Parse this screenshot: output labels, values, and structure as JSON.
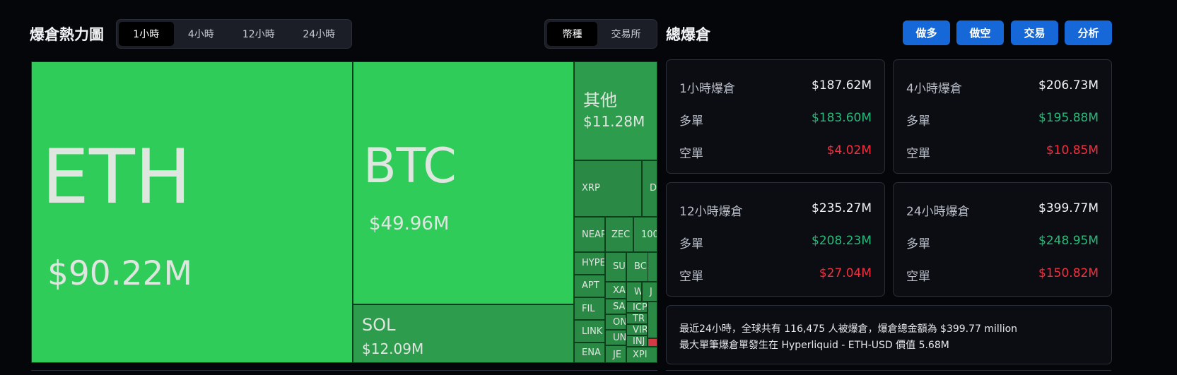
{
  "heatmap": {
    "title": "爆倉熱力圖",
    "time_tabs": [
      "1小時",
      "4小時",
      "12小時",
      "24小時"
    ],
    "active_time_tab": "1小時",
    "group_tabs": [
      "幣種",
      "交易所"
    ],
    "active_group_tab": "幣種",
    "tiles": [
      {
        "symbol": "ETH",
        "value": "$90.22M"
      },
      {
        "symbol": "BTC",
        "value": "$49.96M"
      },
      {
        "symbol": "SOL",
        "value": "$12.09M"
      },
      {
        "symbol": "其他",
        "value": "$11.28M"
      },
      {
        "symbol": "XRP"
      },
      {
        "symbol": "D"
      },
      {
        "symbol": "NEAR"
      },
      {
        "symbol": "ZEC"
      },
      {
        "symbol": "100"
      },
      {
        "symbol": "HYPE"
      },
      {
        "symbol": "SU"
      },
      {
        "symbol": "BC"
      },
      {
        "symbol": "APT"
      },
      {
        "symbol": "XA"
      },
      {
        "symbol": "W"
      },
      {
        "symbol": "J"
      },
      {
        "symbol": "FIL"
      },
      {
        "symbol": "SA"
      },
      {
        "symbol": "ICP"
      },
      {
        "symbol": "TR"
      },
      {
        "symbol": "LINK"
      },
      {
        "symbol": "ON"
      },
      {
        "symbol": "VIR"
      },
      {
        "symbol": "ENA"
      },
      {
        "symbol": "UN"
      },
      {
        "symbol": "INJ"
      },
      {
        "symbol": "JE"
      },
      {
        "symbol": "XPI"
      }
    ]
  },
  "summary": {
    "title": "總爆倉",
    "buttons": [
      "做多",
      "做空",
      "交易",
      "分析"
    ],
    "cards": [
      {
        "label": "1小時爆倉",
        "total": "$187.62M",
        "long_label": "多單",
        "long": "$183.60M",
        "short_label": "空單",
        "short": "$4.02M"
      },
      {
        "label": "4小時爆倉",
        "total": "$206.73M",
        "long_label": "多單",
        "long": "$195.88M",
        "short_label": "空單",
        "short": "$10.85M"
      },
      {
        "label": "12小時爆倉",
        "total": "$235.27M",
        "long_label": "多單",
        "long": "$208.23M",
        "short_label": "空單",
        "short": "$27.04M"
      },
      {
        "label": "24小時爆倉",
        "total": "$399.77M",
        "long_label": "多單",
        "long": "$248.95M",
        "short_label": "空單",
        "short": "$150.82M"
      }
    ],
    "info_line1": "最近24小時，全球共有 116,475 人被爆倉，爆倉總金額為 $399.77 million",
    "info_line2": "最大單筆爆倉單發生在 Hyperliquid - ETH-USD 價值 5.68M"
  },
  "colors": {
    "accent": "#1668d9",
    "long": "#29b97a",
    "short": "#f0303e",
    "tile_bright": "#2fcc5a",
    "tile_mid": "#2e9c4d"
  }
}
